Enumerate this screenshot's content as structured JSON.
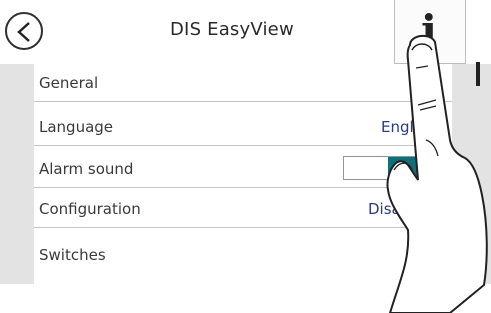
{
  "header": {
    "title": "DIS EasyView",
    "back_icon": "chevron-left-icon",
    "info_label": "i"
  },
  "settings": [
    {
      "label": "General",
      "value": ""
    },
    {
      "label": "Language",
      "value": "English"
    },
    {
      "label": "Alarm sound",
      "toggle_text": "O"
    },
    {
      "label": "Configuration",
      "value": "Disable"
    },
    {
      "label": "Switches",
      "value": ""
    }
  ],
  "colors": {
    "accent": "#0f6f78",
    "value_text": "#283c8c",
    "background": "#e3e3e3"
  }
}
